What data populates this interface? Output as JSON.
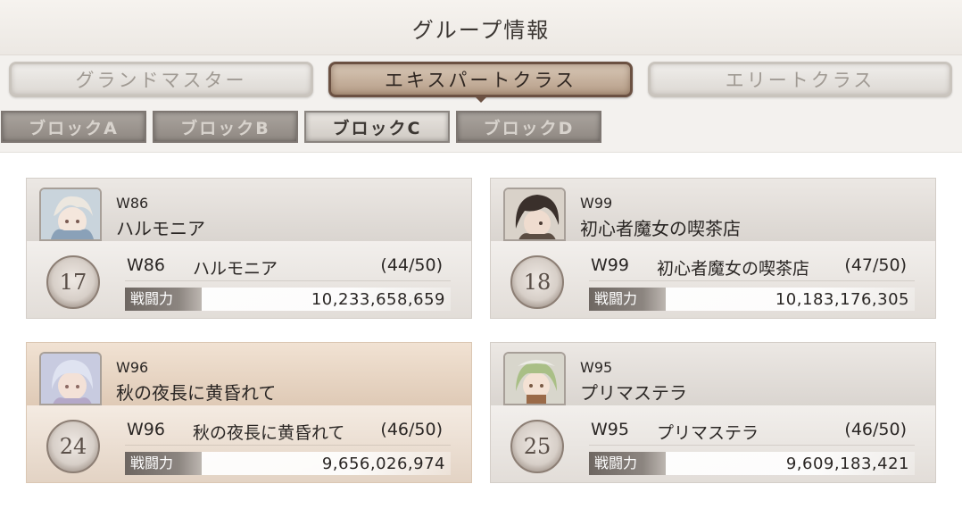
{
  "header": {
    "title": "グループ情報"
  },
  "class_tabs": [
    {
      "label": "グランドマスター",
      "active": false
    },
    {
      "label": "エキスパートクラス",
      "active": true
    },
    {
      "label": "エリートクラス",
      "active": false
    }
  ],
  "block_tabs": [
    {
      "label": "ブロックA",
      "active": false
    },
    {
      "label": "ブロックB",
      "active": false
    },
    {
      "label": "ブロックC",
      "active": true
    },
    {
      "label": "ブロックD",
      "active": false
    }
  ],
  "power_label": "戦闘力",
  "guilds": [
    {
      "server": "W86",
      "name": "ハルモニア",
      "rank": "17",
      "members": "(44/50)",
      "power": "10,233,658,659",
      "highlight": false,
      "avatar_icon": "character-portrait-icon"
    },
    {
      "server": "W99",
      "name": "初心者魔女の喫茶店",
      "rank": "18",
      "members": "(47/50)",
      "power": "10,183,176,305",
      "highlight": false,
      "avatar_icon": "character-portrait-icon"
    },
    {
      "server": "W96",
      "name": "秋の夜長に黄昏れて",
      "rank": "24",
      "members": "(46/50)",
      "power": "9,656,026,974",
      "highlight": true,
      "avatar_icon": "character-portrait-icon"
    },
    {
      "server": "W95",
      "name": "プリマステラ",
      "rank": "25",
      "members": "(46/50)",
      "power": "9,609,183,421",
      "highlight": false,
      "avatar_icon": "character-portrait-icon"
    }
  ],
  "colors": {
    "active_tab_border": "#6b5142",
    "highlight_card": "#ead9c8",
    "power_label_bg": "#6e6762"
  }
}
